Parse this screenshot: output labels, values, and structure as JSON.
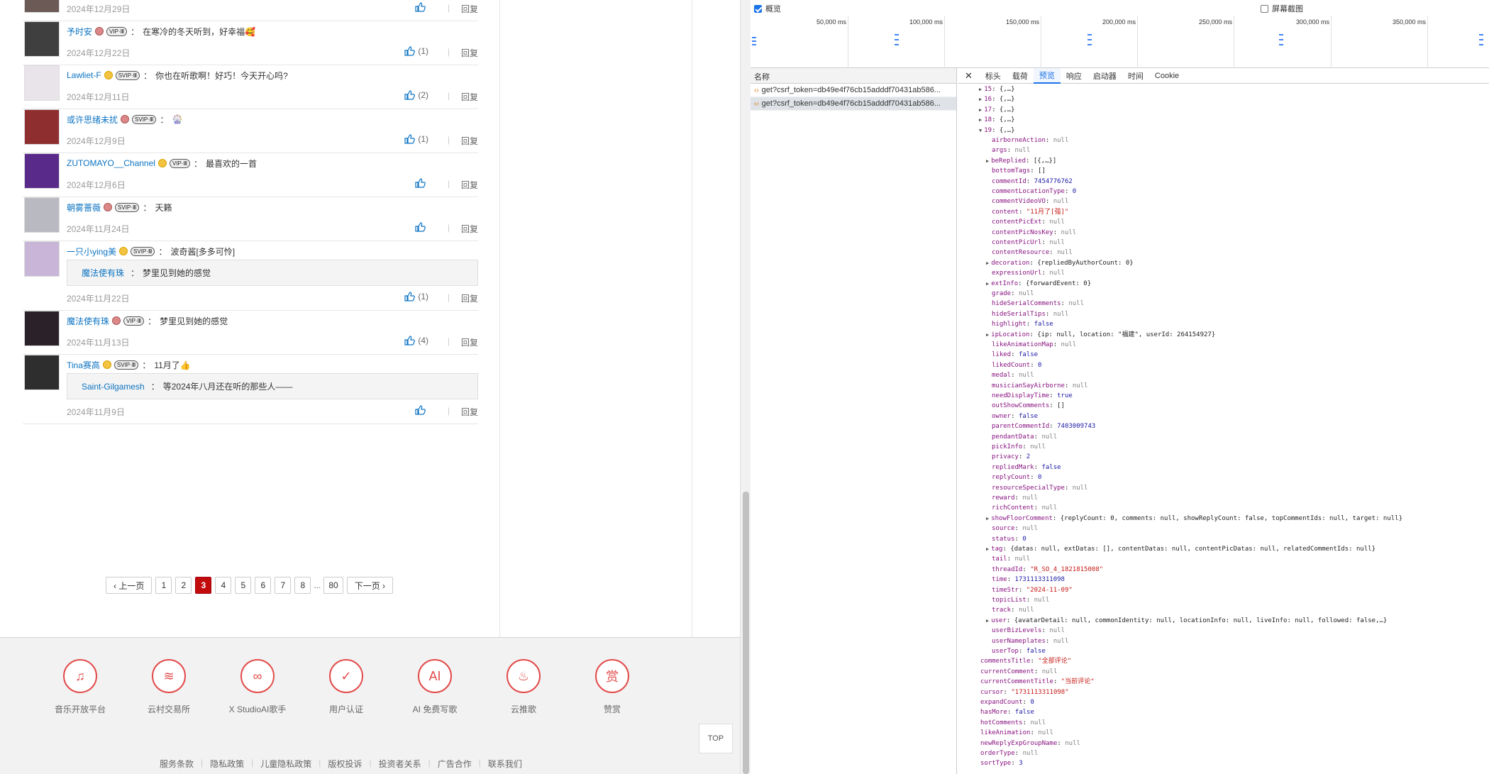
{
  "comments": [
    {
      "user": "",
      "text": "",
      "date": "2024年12月29日",
      "likes": "",
      "reply": "回复"
    },
    {
      "user": "予时安",
      "text": "在寒冷的冬天听到，好幸福🥰",
      "date": "2024年12月22日",
      "likes": "(1)",
      "reply": "回复"
    },
    {
      "user": "Lawliet-F",
      "text": "你也在听歌啊！好巧！今天开心吗?",
      "date": "2024年12月11日",
      "likes": "(2)",
      "reply": "回复"
    },
    {
      "user": "或许思绪未扰",
      "text": "🎡",
      "date": "2024年12月9日",
      "likes": "(1)",
      "reply": "回复"
    },
    {
      "user": "ZUTOMAYO__Channel",
      "text": "最喜欢的一首",
      "date": "2024年12月6日",
      "likes": "",
      "reply": "回复"
    },
    {
      "user": "朝雾蔷薇",
      "text": "天籁",
      "date": "2024年11月24日",
      "likes": "",
      "reply": "回复"
    },
    {
      "user": "一只小ying美",
      "text": "波奇酱[多多可怜]",
      "date": "2024年11月22日",
      "likes": "(1)",
      "reply": "回复",
      "quote_user": "魔法使有珠",
      "quote_text": "梦里见到她的感觉"
    },
    {
      "user": "魔法使有珠",
      "text": "梦里见到她的感觉",
      "date": "2024年11月13日",
      "likes": "(4)",
      "reply": "回复"
    },
    {
      "user": "Tina赛高",
      "text": "11月了👍",
      "date": "2024年11月9日",
      "likes": "",
      "reply": "回复",
      "quote_user": "Saint-Gilgamesh",
      "quote_text": "等2024年八月还在听的那些人——"
    }
  ],
  "badges": {
    "vip": "VIP·Ⅲ",
    "svip": "SVIP·Ⅲ"
  },
  "pager": {
    "prev": "‹ 上一页",
    "next": "下一页 ›",
    "pages": [
      "1",
      "2",
      "3",
      "4",
      "5",
      "6",
      "7",
      "8"
    ],
    "current": "3",
    "dots": "...",
    "last": "80"
  },
  "footer": {
    "items": [
      {
        "label": "音乐开放平台",
        "icon": "music-platform-icon",
        "glyph": "♫"
      },
      {
        "label": "云村交易所",
        "icon": "exchange-icon",
        "glyph": "≋"
      },
      {
        "label": "X StudioAI歌手",
        "icon": "xstudio-icon",
        "glyph": "∞"
      },
      {
        "label": "用户认证",
        "icon": "shield-icon",
        "glyph": "✓"
      },
      {
        "label": "AI 免费写歌",
        "icon": "ai-icon",
        "glyph": "AI"
      },
      {
        "label": "云推歌",
        "icon": "push-song-icon",
        "glyph": "♨"
      },
      {
        "label": "赞赏",
        "icon": "reward-icon",
        "glyph": "赏"
      }
    ],
    "top": "TOP",
    "links": [
      "服务条款",
      "隐私政策",
      "儿童隐私政策",
      "版权投诉",
      "投资者关系",
      "广告合作",
      "联系我们"
    ]
  },
  "devtools": {
    "overview_label": "概览",
    "screenshot_label": "屏幕截图",
    "ticks": [
      "50,000 ms",
      "100,000 ms",
      "150,000 ms",
      "200,000 ms",
      "250,000 ms",
      "300,000 ms",
      "350,000 ms"
    ],
    "names_header": "名称",
    "requests": [
      "get?csrf_token=db49e4f76cb15adddf70431ab586...",
      "get?csrf_token=db49e4f76cb15adddf70431ab586..."
    ],
    "tabs": [
      "标头",
      "载荷",
      "预览",
      "响应",
      "启动器",
      "时间",
      "Cookie"
    ],
    "active_tab": "预览",
    "tree": [
      {
        "lv": 0,
        "arrow": "▶",
        "t": [
          [
            "k",
            "15"
          ],
          [
            "o",
            ": {,…}"
          ]
        ]
      },
      {
        "lv": 0,
        "arrow": "▶",
        "t": [
          [
            "k",
            "16"
          ],
          [
            "o",
            ": {,…}"
          ]
        ]
      },
      {
        "lv": 0,
        "arrow": "▶",
        "t": [
          [
            "k",
            "17"
          ],
          [
            "o",
            ": {,…}"
          ]
        ]
      },
      {
        "lv": 0,
        "arrow": "▶",
        "t": [
          [
            "k",
            "18"
          ],
          [
            "o",
            ": {,…}"
          ]
        ]
      },
      {
        "lv": 0,
        "arrow": "▼",
        "t": [
          [
            "k",
            "19"
          ],
          [
            "o",
            ": {,…}"
          ]
        ]
      },
      {
        "lv": 1,
        "t": [
          [
            "k",
            "airborneAction"
          ],
          [
            "o",
            ": "
          ],
          [
            "nl",
            "null"
          ]
        ]
      },
      {
        "lv": 1,
        "t": [
          [
            "k",
            "args"
          ],
          [
            "o",
            ": "
          ],
          [
            "nl",
            "null"
          ]
        ]
      },
      {
        "lv": 1,
        "arrow": "▶",
        "t": [
          [
            "k",
            "beReplied"
          ],
          [
            "o",
            ": [{,…}]"
          ]
        ]
      },
      {
        "lv": 1,
        "t": [
          [
            "k",
            "bottomTags"
          ],
          [
            "o",
            ": []"
          ]
        ]
      },
      {
        "lv": 1,
        "t": [
          [
            "k",
            "commentId"
          ],
          [
            "o",
            ": "
          ],
          [
            "n",
            "7454776762"
          ]
        ]
      },
      {
        "lv": 1,
        "t": [
          [
            "k",
            "commentLocationType"
          ],
          [
            "o",
            ": "
          ],
          [
            "n",
            "0"
          ]
        ]
      },
      {
        "lv": 1,
        "t": [
          [
            "k",
            "commentVideoVO"
          ],
          [
            "o",
            ": "
          ],
          [
            "nl",
            "null"
          ]
        ]
      },
      {
        "lv": 1,
        "t": [
          [
            "k",
            "content"
          ],
          [
            "o",
            ": "
          ],
          [
            "s",
            "\"11月了[强]\""
          ]
        ]
      },
      {
        "lv": 1,
        "t": [
          [
            "k",
            "contentPicExt"
          ],
          [
            "o",
            ": "
          ],
          [
            "nl",
            "null"
          ]
        ]
      },
      {
        "lv": 1,
        "t": [
          [
            "k",
            "contentPicNosKey"
          ],
          [
            "o",
            ": "
          ],
          [
            "nl",
            "null"
          ]
        ]
      },
      {
        "lv": 1,
        "t": [
          [
            "k",
            "contentPicUrl"
          ],
          [
            "o",
            ": "
          ],
          [
            "nl",
            "null"
          ]
        ]
      },
      {
        "lv": 1,
        "t": [
          [
            "k",
            "contentResource"
          ],
          [
            "o",
            ": "
          ],
          [
            "nl",
            "null"
          ]
        ]
      },
      {
        "lv": 1,
        "arrow": "▶",
        "t": [
          [
            "k",
            "decoration"
          ],
          [
            "o",
            ": {repliedByAuthorCount: 0}"
          ]
        ]
      },
      {
        "lv": 1,
        "t": [
          [
            "k",
            "expressionUrl"
          ],
          [
            "o",
            ": "
          ],
          [
            "nl",
            "null"
          ]
        ]
      },
      {
        "lv": 1,
        "arrow": "▶",
        "t": [
          [
            "k",
            "extInfo"
          ],
          [
            "o",
            ": {forwardEvent: 0}"
          ]
        ]
      },
      {
        "lv": 1,
        "t": [
          [
            "k",
            "grade"
          ],
          [
            "o",
            ": "
          ],
          [
            "nl",
            "null"
          ]
        ]
      },
      {
        "lv": 1,
        "t": [
          [
            "k",
            "hideSerialComments"
          ],
          [
            "o",
            ": "
          ],
          [
            "nl",
            "null"
          ]
        ]
      },
      {
        "lv": 1,
        "t": [
          [
            "k",
            "hideSerialTips"
          ],
          [
            "o",
            ": "
          ],
          [
            "nl",
            "null"
          ]
        ]
      },
      {
        "lv": 1,
        "t": [
          [
            "k",
            "highlight"
          ],
          [
            "o",
            ": "
          ],
          [
            "n",
            "false"
          ]
        ]
      },
      {
        "lv": 1,
        "arrow": "▶",
        "t": [
          [
            "k",
            "ipLocation"
          ],
          [
            "o",
            ": {ip: null, location: \"福建\", userId: 264154927}"
          ]
        ]
      },
      {
        "lv": 1,
        "t": [
          [
            "k",
            "likeAnimationMap"
          ],
          [
            "o",
            ": "
          ],
          [
            "nl",
            "null"
          ]
        ]
      },
      {
        "lv": 1,
        "t": [
          [
            "k",
            "liked"
          ],
          [
            "o",
            ": "
          ],
          [
            "n",
            "false"
          ]
        ]
      },
      {
        "lv": 1,
        "t": [
          [
            "k",
            "likedCount"
          ],
          [
            "o",
            ": "
          ],
          [
            "n",
            "0"
          ]
        ]
      },
      {
        "lv": 1,
        "t": [
          [
            "k",
            "medal"
          ],
          [
            "o",
            ": "
          ],
          [
            "nl",
            "null"
          ]
        ]
      },
      {
        "lv": 1,
        "t": [
          [
            "k",
            "musicianSayAirborne"
          ],
          [
            "o",
            ": "
          ],
          [
            "nl",
            "null"
          ]
        ]
      },
      {
        "lv": 1,
        "t": [
          [
            "k",
            "needDisplayTime"
          ],
          [
            "o",
            ": "
          ],
          [
            "n",
            "true"
          ]
        ]
      },
      {
        "lv": 1,
        "t": [
          [
            "k",
            "outShowComments"
          ],
          [
            "o",
            ": []"
          ]
        ]
      },
      {
        "lv": 1,
        "t": [
          [
            "k",
            "owner"
          ],
          [
            "o",
            ": "
          ],
          [
            "n",
            "false"
          ]
        ]
      },
      {
        "lv": 1,
        "t": [
          [
            "k",
            "parentCommentId"
          ],
          [
            "o",
            ": "
          ],
          [
            "n",
            "7403009743"
          ]
        ]
      },
      {
        "lv": 1,
        "t": [
          [
            "k",
            "pendantData"
          ],
          [
            "o",
            ": "
          ],
          [
            "nl",
            "null"
          ]
        ]
      },
      {
        "lv": 1,
        "t": [
          [
            "k",
            "pickInfo"
          ],
          [
            "o",
            ": "
          ],
          [
            "nl",
            "null"
          ]
        ]
      },
      {
        "lv": 1,
        "t": [
          [
            "k",
            "privacy"
          ],
          [
            "o",
            ": "
          ],
          [
            "n",
            "2"
          ]
        ]
      },
      {
        "lv": 1,
        "t": [
          [
            "k",
            "repliedMark"
          ],
          [
            "o",
            ": "
          ],
          [
            "n",
            "false"
          ]
        ]
      },
      {
        "lv": 1,
        "t": [
          [
            "k",
            "replyCount"
          ],
          [
            "o",
            ": "
          ],
          [
            "n",
            "0"
          ]
        ]
      },
      {
        "lv": 1,
        "t": [
          [
            "k",
            "resourceSpecialType"
          ],
          [
            "o",
            ": "
          ],
          [
            "nl",
            "null"
          ]
        ]
      },
      {
        "lv": 1,
        "t": [
          [
            "k",
            "reward"
          ],
          [
            "o",
            ": "
          ],
          [
            "nl",
            "null"
          ]
        ]
      },
      {
        "lv": 1,
        "t": [
          [
            "k",
            "richContent"
          ],
          [
            "o",
            ": "
          ],
          [
            "nl",
            "null"
          ]
        ]
      },
      {
        "lv": 1,
        "arrow": "▶",
        "t": [
          [
            "k",
            "showFloorComment"
          ],
          [
            "o",
            ": {replyCount: 0, comments: null, showReplyCount: false, topCommentIds: null, target: null}"
          ]
        ]
      },
      {
        "lv": 1,
        "t": [
          [
            "k",
            "source"
          ],
          [
            "o",
            ": "
          ],
          [
            "nl",
            "null"
          ]
        ]
      },
      {
        "lv": 1,
        "t": [
          [
            "k",
            "status"
          ],
          [
            "o",
            ": "
          ],
          [
            "n",
            "0"
          ]
        ]
      },
      {
        "lv": 1,
        "arrow": "▶",
        "t": [
          [
            "k",
            "tag"
          ],
          [
            "o",
            ": {datas: null, extDatas: [], contentDatas: null, contentPicDatas: null, relatedCommentIds: null}"
          ]
        ]
      },
      {
        "lv": 1,
        "t": [
          [
            "k",
            "tail"
          ],
          [
            "o",
            ": "
          ],
          [
            "nl",
            "null"
          ]
        ]
      },
      {
        "lv": 1,
        "t": [
          [
            "k",
            "threadId"
          ],
          [
            "o",
            ": "
          ],
          [
            "s",
            "\"R_SO_4_1821815008\""
          ]
        ]
      },
      {
        "lv": 1,
        "t": [
          [
            "k",
            "time"
          ],
          [
            "o",
            ": "
          ],
          [
            "n",
            "1731113311098"
          ]
        ]
      },
      {
        "lv": 1,
        "t": [
          [
            "k",
            "timeStr"
          ],
          [
            "o",
            ": "
          ],
          [
            "s",
            "\"2024-11-09\""
          ]
        ]
      },
      {
        "lv": 1,
        "t": [
          [
            "k",
            "topicList"
          ],
          [
            "o",
            ": "
          ],
          [
            "nl",
            "null"
          ]
        ]
      },
      {
        "lv": 1,
        "t": [
          [
            "k",
            "track"
          ],
          [
            "o",
            ": "
          ],
          [
            "nl",
            "null"
          ]
        ]
      },
      {
        "lv": 1,
        "arrow": "▶",
        "t": [
          [
            "k",
            "user"
          ],
          [
            "o",
            ": {avatarDetail: null, commonIdentity: null, locationInfo: null, liveInfo: null, followed: false,…}"
          ]
        ]
      },
      {
        "lv": 1,
        "t": [
          [
            "k",
            "userBizLevels"
          ],
          [
            "o",
            ": "
          ],
          [
            "nl",
            "null"
          ]
        ]
      },
      {
        "lv": 1,
        "t": [
          [
            "k",
            "userNameplates"
          ],
          [
            "o",
            ": "
          ],
          [
            "nl",
            "null"
          ]
        ]
      },
      {
        "lv": 1,
        "t": [
          [
            "k",
            "userTop"
          ],
          [
            "o",
            ": "
          ],
          [
            "n",
            "false"
          ]
        ]
      },
      {
        "lv": -1,
        "t": [
          [
            "k",
            "commentsTitle"
          ],
          [
            "o",
            ": "
          ],
          [
            "s",
            "\"全部评论\""
          ]
        ]
      },
      {
        "lv": -1,
        "t": [
          [
            "k",
            "currentComment"
          ],
          [
            "o",
            ": "
          ],
          [
            "nl",
            "null"
          ]
        ]
      },
      {
        "lv": -1,
        "t": [
          [
            "k",
            "currentCommentTitle"
          ],
          [
            "o",
            ": "
          ],
          [
            "s",
            "\"当前评论\""
          ]
        ]
      },
      {
        "lv": -1,
        "t": [
          [
            "k",
            "cursor"
          ],
          [
            "o",
            ": "
          ],
          [
            "s",
            "\"1731113311098\""
          ]
        ]
      },
      {
        "lv": -1,
        "t": [
          [
            "k",
            "expandCount"
          ],
          [
            "o",
            ": "
          ],
          [
            "n",
            "0"
          ]
        ]
      },
      {
        "lv": -1,
        "t": [
          [
            "k",
            "hasMore"
          ],
          [
            "o",
            ": "
          ],
          [
            "n",
            "false"
          ]
        ]
      },
      {
        "lv": -1,
        "t": [
          [
            "k",
            "hotComments"
          ],
          [
            "o",
            ": "
          ],
          [
            "nl",
            "null"
          ]
        ]
      },
      {
        "lv": -1,
        "t": [
          [
            "k",
            "likeAnimation"
          ],
          [
            "o",
            ": "
          ],
          [
            "nl",
            "null"
          ]
        ]
      },
      {
        "lv": -1,
        "t": [
          [
            "k",
            "newReplyExpGroupName"
          ],
          [
            "o",
            ": "
          ],
          [
            "nl",
            "null"
          ]
        ]
      },
      {
        "lv": -1,
        "t": [
          [
            "k",
            "orderType"
          ],
          [
            "o",
            ": "
          ],
          [
            "nl",
            "null"
          ]
        ]
      },
      {
        "lv": -1,
        "t": [
          [
            "k",
            "sortType"
          ],
          [
            "o",
            ": "
          ],
          [
            "n",
            "3"
          ]
        ]
      }
    ]
  }
}
